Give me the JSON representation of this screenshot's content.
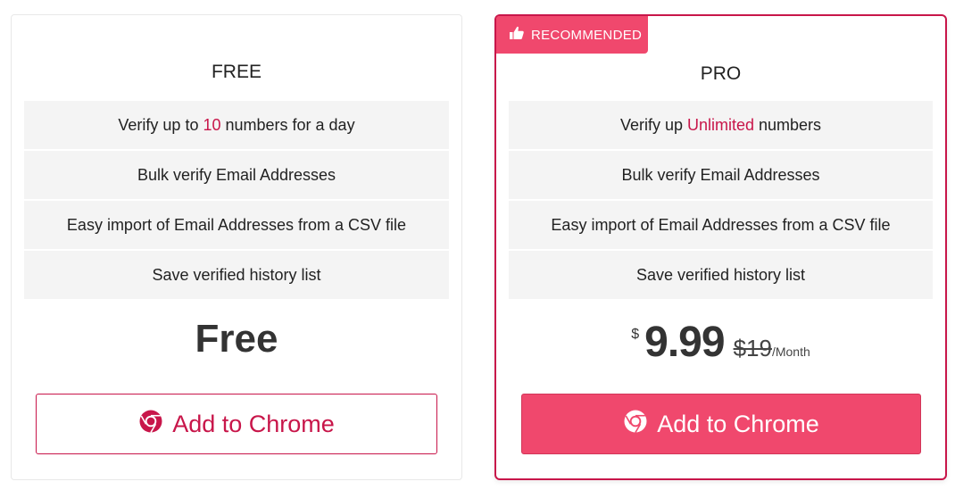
{
  "plans": {
    "free": {
      "title": "FREE",
      "features": [
        {
          "pre": "Verify up to",
          "highlight": "10",
          "post": "numbers for a day"
        },
        {
          "text": "Bulk verify Email Addresses"
        },
        {
          "text": "Easy import of Email Addresses from a CSV file"
        },
        {
          "text": "Save verified history list"
        }
      ],
      "price": "Free",
      "button_label": "Add to Chrome",
      "button_icon": "chrome-icon"
    },
    "pro": {
      "badge_label": "RECOMMENDED",
      "badge_icon": "thumbs-up-icon",
      "title": "PRO",
      "features": [
        {
          "pre": "Verify up",
          "highlight": "Unlimited",
          "post": "numbers"
        },
        {
          "text": "Bulk verify Email Addresses"
        },
        {
          "text": "Easy import of Email Addresses from a CSV file"
        },
        {
          "text": "Save verified history list"
        }
      ],
      "currency": "$",
      "price": "9.99",
      "old_price": "$19",
      "period": "/Month",
      "button_label": "Add to Chrome",
      "button_icon": "chrome-icon"
    }
  },
  "colors": {
    "accent": "#c8164a",
    "button_fill": "#f0486d",
    "feature_bg": "#f4f4f4"
  }
}
